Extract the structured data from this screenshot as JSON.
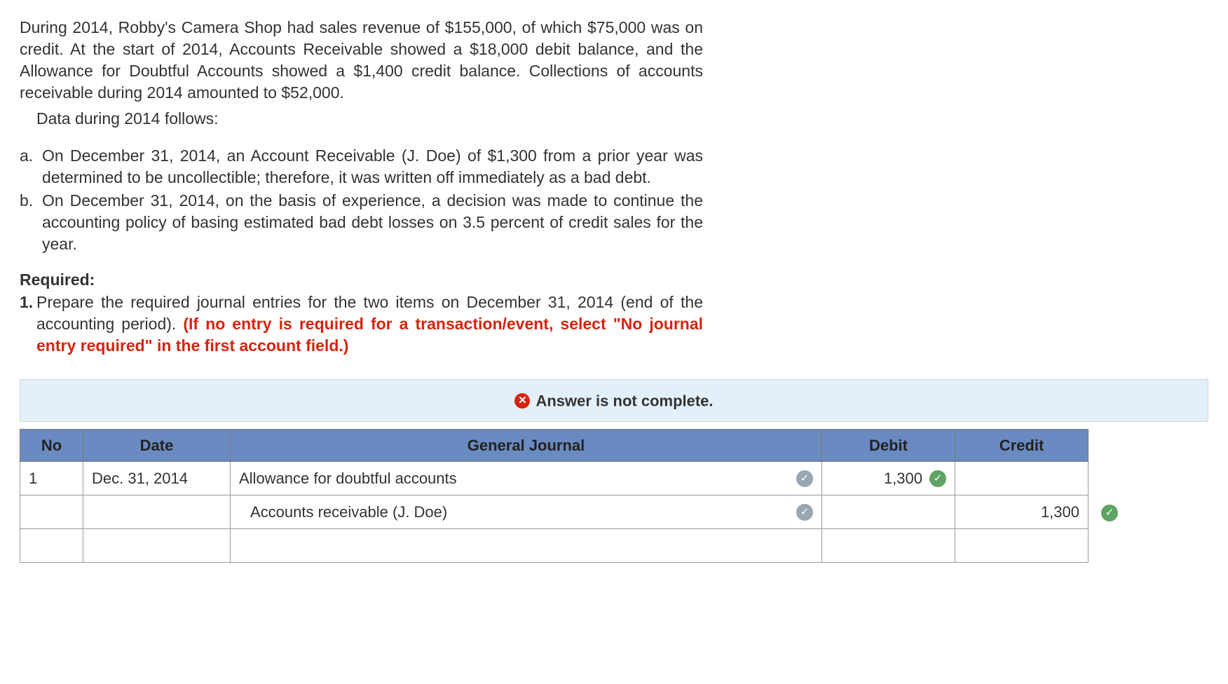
{
  "question": {
    "intro": "During 2014, Robby's Camera Shop had sales revenue of $155,000, of which $75,000 was on credit. At the start of 2014, Accounts Receivable showed a $18,000 debit balance, and the Allowance for Doubtful Accounts showed a $1,400 credit balance. Collections of accounts receivable during 2014 amounted to $52,000.",
    "data_follows": "Data during 2014 follows:",
    "items": [
      {
        "marker": "a.",
        "text": "On December 31, 2014, an Account Receivable (J. Doe) of $1,300 from a prior year was determined to be uncollectible; therefore, it was written off immediately as a bad debt."
      },
      {
        "marker": "b.",
        "text": "On December 31, 2014, on the basis of experience, a decision was made to continue the accounting policy of basing estimated bad debt losses on 3.5 percent of credit sales for the year."
      }
    ],
    "required_label": "Required:",
    "required_item": {
      "marker": "1.",
      "plain": "Prepare the required journal entries for the two items on December 31, 2014 (end of the accounting period). ",
      "red": "(If no entry is required for a transaction/event, select \"No journal entry required\" in the first account field.)"
    }
  },
  "status": {
    "icon": "x",
    "text": "Answer is not complete."
  },
  "table": {
    "headers": {
      "no": "No",
      "date": "Date",
      "gj": "General Journal",
      "debit": "Debit",
      "credit": "Credit"
    },
    "rows": [
      {
        "no": "1",
        "date": "Dec. 31, 2014",
        "account": "Allowance for doubtful accounts",
        "acct_check": "gray",
        "indent": false,
        "debit": "1,300",
        "debit_check": "green",
        "credit": "",
        "outside_check": ""
      },
      {
        "no": "",
        "date": "",
        "account": "Accounts receivable (J. Doe)",
        "acct_check": "gray",
        "indent": true,
        "debit": "",
        "debit_check": "",
        "credit": "1,300",
        "outside_check": "green"
      },
      {
        "no": "",
        "date": "",
        "account": "",
        "acct_check": "",
        "indent": false,
        "debit": "",
        "debit_check": "",
        "credit": "",
        "outside_check": ""
      }
    ]
  }
}
